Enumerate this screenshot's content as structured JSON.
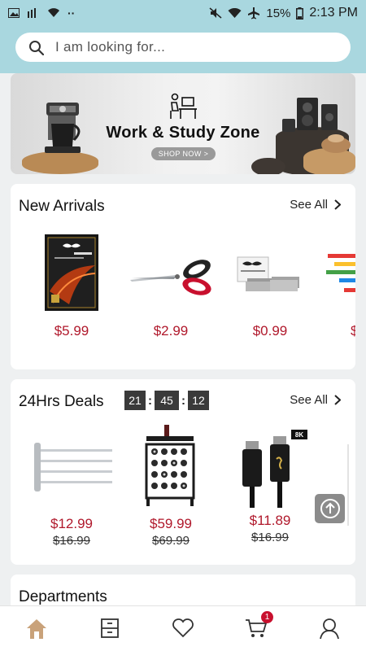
{
  "status_bar": {
    "battery": "15%",
    "time": "2:13 PM"
  },
  "search": {
    "placeholder": "I am looking for..."
  },
  "banner": {
    "title": "Work & Study Zone",
    "cta": "SHOP NOW >"
  },
  "new_arrivals": {
    "title": "New Arrivals",
    "see_all": "See All",
    "products": [
      {
        "price": "$5.99",
        "icon": "photo-paper-pack"
      },
      {
        "price": "$2.99",
        "icon": "scissors"
      },
      {
        "price": "$0.99",
        "icon": "staples-box"
      },
      {
        "price": "$",
        "icon": "sticky-flags"
      }
    ]
  },
  "deals": {
    "title": "24Hrs Deals",
    "see_all": "See All",
    "timer": {
      "hours": "21",
      "minutes": "45",
      "seconds": "12"
    },
    "products": [
      {
        "price": "$12.99",
        "old_price": "$16.99",
        "icon": "towel-bar-rack"
      },
      {
        "price": "$59.99",
        "old_price": "$69.99",
        "icon": "wine-rack"
      },
      {
        "price": "$11.89",
        "old_price": "$16.99",
        "icon": "hdmi-cable",
        "badge": "8K"
      }
    ]
  },
  "departments": {
    "title": "Departments"
  },
  "bottom_nav": {
    "cart_count": "1",
    "items": [
      "home",
      "catalog",
      "wishlist",
      "cart",
      "account"
    ]
  },
  "colors": {
    "header": "#a9d7df",
    "price": "#b0182b",
    "active_nav": "#c9a27a"
  }
}
